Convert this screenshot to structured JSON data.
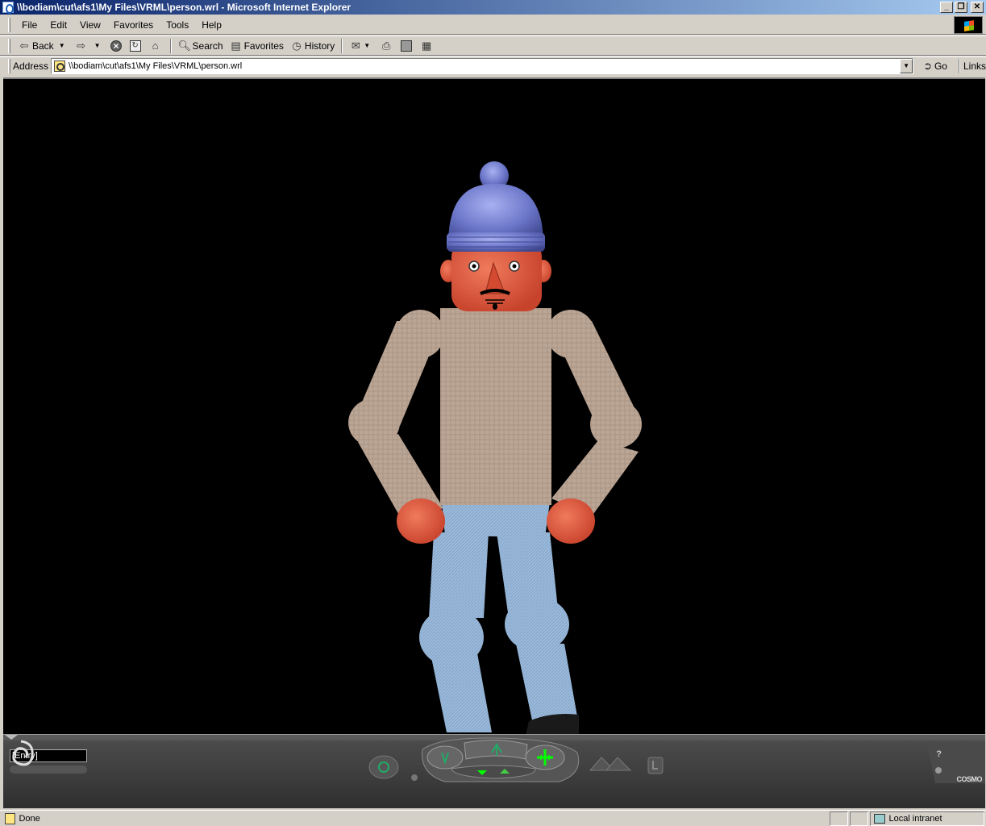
{
  "window": {
    "title": "\\\\bodiam\\cut\\afs1\\My Files\\VRML\\person.wrl - Microsoft Internet Explorer",
    "minimize": "_",
    "maximize": "❐",
    "close": "✕"
  },
  "menu": {
    "file": "File",
    "edit": "Edit",
    "view": "View",
    "favorites": "Favorites",
    "tools": "Tools",
    "help": "Help"
  },
  "toolbar": {
    "back": "Back",
    "search": "Search",
    "favorites": "Favorites",
    "history": "History"
  },
  "address": {
    "label": "Address",
    "value": "\\\\bodiam\\cut\\afs1\\My Files\\VRML\\person.wrl",
    "go": "Go",
    "links": "Links"
  },
  "cosmo": {
    "viewpoint": "[Entry]",
    "help": "?",
    "logo_text": "COSMO"
  },
  "status": {
    "text": "Done",
    "zone": "Local intranet"
  },
  "colors": {
    "skin": "#e0553a",
    "sweater": "#b8a496",
    "jeans": "#9bbadb",
    "hat": "#6a75c8",
    "background": "#000000"
  }
}
